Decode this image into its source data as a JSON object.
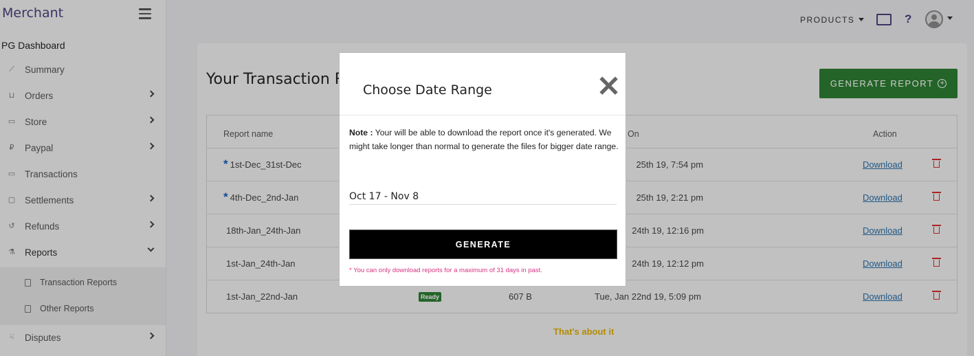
{
  "sidebar": {
    "brand": "Merchant",
    "section": "PG Dashboard",
    "items": [
      {
        "label": "Summary",
        "icon": "chart-icon"
      },
      {
        "label": "Orders",
        "icon": "cart-icon"
      },
      {
        "label": "Store",
        "icon": "store-icon"
      },
      {
        "label": "Paypal",
        "icon": "paypal-icon"
      },
      {
        "label": "Transactions",
        "icon": "cash-icon"
      },
      {
        "label": "Settlements",
        "icon": "bag-icon"
      },
      {
        "label": "Refunds",
        "icon": "refund-icon"
      },
      {
        "label": "Reports",
        "icon": "report-icon"
      },
      {
        "label": "Disputes",
        "icon": "thumbs-down-icon"
      }
    ],
    "sub_items": [
      "Transaction Reports",
      "Other Reports"
    ]
  },
  "topbar": {
    "products_label": "PRODUCTS",
    "help": "?"
  },
  "page": {
    "title": "Your Transaction Reports",
    "generate_report_label": "GENERATE REPORT",
    "footer_note": "That's about it"
  },
  "table": {
    "headers": [
      "Report name",
      "On",
      "Action"
    ],
    "rows": [
      {
        "name": "1st-Dec_31st-Dec",
        "starred": true,
        "date": "25th 19, 7:54 pm",
        "action": "Download"
      },
      {
        "name": "4th-Dec_2nd-Jan",
        "starred": true,
        "date": "25th 19, 2:21 pm",
        "action": "Download"
      },
      {
        "name": "18th-Jan_24th-Jan",
        "starred": false,
        "date": "24th 19, 12:16 pm",
        "action": "Download"
      },
      {
        "name": "1st-Jan_24th-Jan",
        "starred": false,
        "date": "24th 19, 12:12 pm",
        "action": "Download"
      },
      {
        "name": "1st-Jan_22nd-Jan",
        "starred": false,
        "status": "Ready",
        "size": "607 B",
        "date": "Tue, Jan 22nd 19, 5:09 pm",
        "action": "Download"
      }
    ]
  },
  "modal": {
    "title": "Choose Date Range",
    "close": "✕",
    "note_label": "Note :",
    "note_text": " Your will be able to download the report once it's generated. We might take longer than normal to generate the files for bigger date range.",
    "date_value": "Oct 17 - Nov 8",
    "generate_label": "GENERATE",
    "warning": "* You can only download reports for a maximum of 31 days in past."
  },
  "colors": {
    "brand": "#4b3f7e",
    "primary_green": "#2e7d32",
    "danger": "#d32f2f",
    "link": "#2a6fa8",
    "warning_text": "#d63384",
    "footnote": "#e0b000"
  }
}
